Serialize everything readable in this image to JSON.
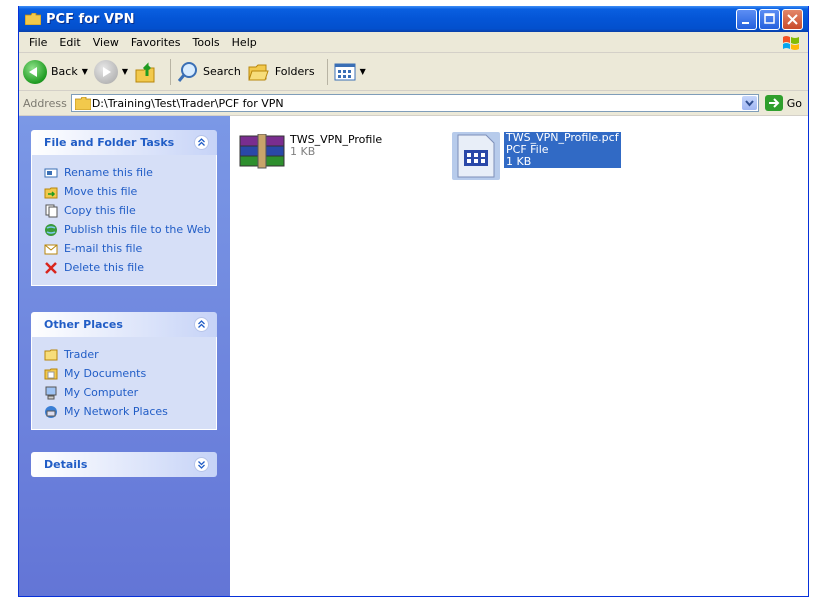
{
  "window": {
    "title": "PCF for VPN"
  },
  "menu": [
    "File",
    "Edit",
    "View",
    "Favorites",
    "Tools",
    "Help"
  ],
  "toolbar": {
    "back": "Back",
    "search": "Search",
    "folders": "Folders"
  },
  "address": {
    "label": "Address",
    "path": "D:\\Training\\Test\\Trader\\PCF for VPN",
    "go": "Go"
  },
  "tasks_panel": {
    "title": "File and Folder Tasks",
    "items": [
      "Rename this file",
      "Move this file",
      "Copy this file",
      "Publish this file to the Web",
      "E-mail this file",
      "Delete this file"
    ]
  },
  "places_panel": {
    "title": "Other Places",
    "items": [
      "Trader",
      "My Documents",
      "My Computer",
      "My Network Places"
    ]
  },
  "details_panel": {
    "title": "Details"
  },
  "files": [
    {
      "name": "TWS_VPN_Profile",
      "line2": "1 KB",
      "icon": "winrar-archive-icon"
    },
    {
      "name": "TWS_VPN_Profile.pcf",
      "line2": "PCF File",
      "line3": "1 KB",
      "icon": "pcf-file-icon",
      "selected": true
    }
  ],
  "colors": {
    "title_blue": "#0455d6",
    "link_blue": "#215dc6",
    "selection": "#316ac5"
  }
}
